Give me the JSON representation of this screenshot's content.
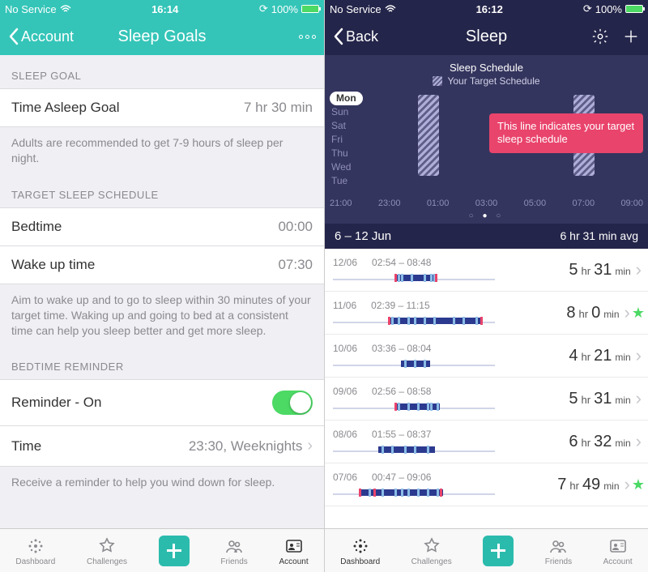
{
  "left": {
    "status": {
      "carrier": "No Service",
      "time": "16:14",
      "battery": "100%"
    },
    "nav": {
      "back": "Account",
      "title": "Sleep Goals"
    },
    "goal": {
      "header": "SLEEP GOAL",
      "label": "Time Asleep Goal",
      "value": "7 hr 30 min",
      "footer": "Adults are recommended to get 7-9 hours of sleep per night."
    },
    "schedule": {
      "header": "TARGET SLEEP SCHEDULE",
      "bed_label": "Bedtime",
      "bed_value": "00:00",
      "wake_label": "Wake up time",
      "wake_value": "07:30",
      "footer": "Aim to wake up and to go to sleep within 30 minutes of your target time. Waking up and going to bed at a consistent time can help you sleep better and get more sleep."
    },
    "reminder": {
      "header": "BEDTIME REMINDER",
      "on_label": "Reminder - On",
      "time_label": "Time",
      "time_value": "23:30, Weeknights",
      "footer": "Receive a reminder to help you wind down for sleep."
    }
  },
  "right": {
    "status": {
      "carrier": "No Service",
      "time": "16:12",
      "battery": "100%"
    },
    "nav": {
      "back": "Back",
      "title": "Sleep"
    },
    "chart": {
      "title": "Sleep Schedule",
      "sub": "Your Target Schedule",
      "days": [
        "Mon",
        "Sun",
        "Sat",
        "Fri",
        "Thu",
        "Wed",
        "Tue"
      ],
      "xticks": [
        "21:00",
        "23:00",
        "01:00",
        "03:00",
        "05:00",
        "07:00",
        "09:00"
      ],
      "tooltip": "This line indicates your target sleep schedule"
    },
    "week": {
      "range": "6 – 12 Jun",
      "avg": "6 hr 31 min avg"
    },
    "logs": [
      {
        "date": "12/06",
        "span": "02:54 – 08:48",
        "h": "5",
        "m": "31",
        "star": false,
        "bar": {
          "start": 38,
          "end": 64,
          "wakes": [
            40,
            42,
            48,
            56,
            60,
            62
          ],
          "pinks": [
            38,
            63
          ]
        }
      },
      {
        "date": "11/06",
        "span": "02:39 – 11:15",
        "h": "8",
        "m": "0",
        "star": true,
        "bar": {
          "start": 34,
          "end": 92,
          "wakes": [
            36,
            40,
            46,
            50,
            56,
            62,
            74,
            80,
            88
          ],
          "pinks": [
            34,
            91
          ]
        }
      },
      {
        "date": "10/06",
        "span": "03:36 – 08:04",
        "h": "4",
        "m": "21",
        "star": false,
        "bar": {
          "start": 42,
          "end": 60,
          "wakes": [
            44,
            50,
            56
          ],
          "pinks": []
        }
      },
      {
        "date": "09/06",
        "span": "02:56 – 08:58",
        "h": "5",
        "m": "31",
        "star": false,
        "bar": {
          "start": 38,
          "end": 66,
          "wakes": [
            40,
            46,
            52,
            58,
            60,
            64
          ],
          "pinks": [
            38
          ]
        }
      },
      {
        "date": "08/06",
        "span": "01:55 – 08:37",
        "h": "6",
        "m": "32",
        "star": false,
        "bar": {
          "start": 28,
          "end": 63,
          "wakes": [
            30,
            36,
            44,
            50,
            58
          ],
          "pinks": []
        }
      },
      {
        "date": "07/06",
        "span": "00:47 – 09:06",
        "h": "7",
        "m": "49",
        "star": true,
        "bar": {
          "start": 16,
          "end": 68,
          "wakes": [
            22,
            30,
            38,
            42,
            46,
            52,
            58,
            64
          ],
          "pinks": [
            16,
            25,
            66
          ]
        }
      }
    ]
  },
  "tabs": [
    {
      "id": "dashboard",
      "label": "Dashboard"
    },
    {
      "id": "challenges",
      "label": "Challenges"
    },
    {
      "id": "add",
      "label": ""
    },
    {
      "id": "friends",
      "label": "Friends"
    },
    {
      "id": "account",
      "label": "Account"
    }
  ],
  "chart_data": {
    "type": "bar",
    "title": "Sleep Schedule – Your Target Schedule",
    "x_range_hours": [
      21,
      33
    ],
    "target_bedtime": "00:00",
    "target_wake": "07:30",
    "days": [
      "Mon",
      "Sun",
      "Sat",
      "Fri",
      "Thu",
      "Wed",
      "Tue"
    ],
    "xticks": [
      "21:00",
      "23:00",
      "01:00",
      "03:00",
      "05:00",
      "07:00",
      "09:00"
    ]
  }
}
